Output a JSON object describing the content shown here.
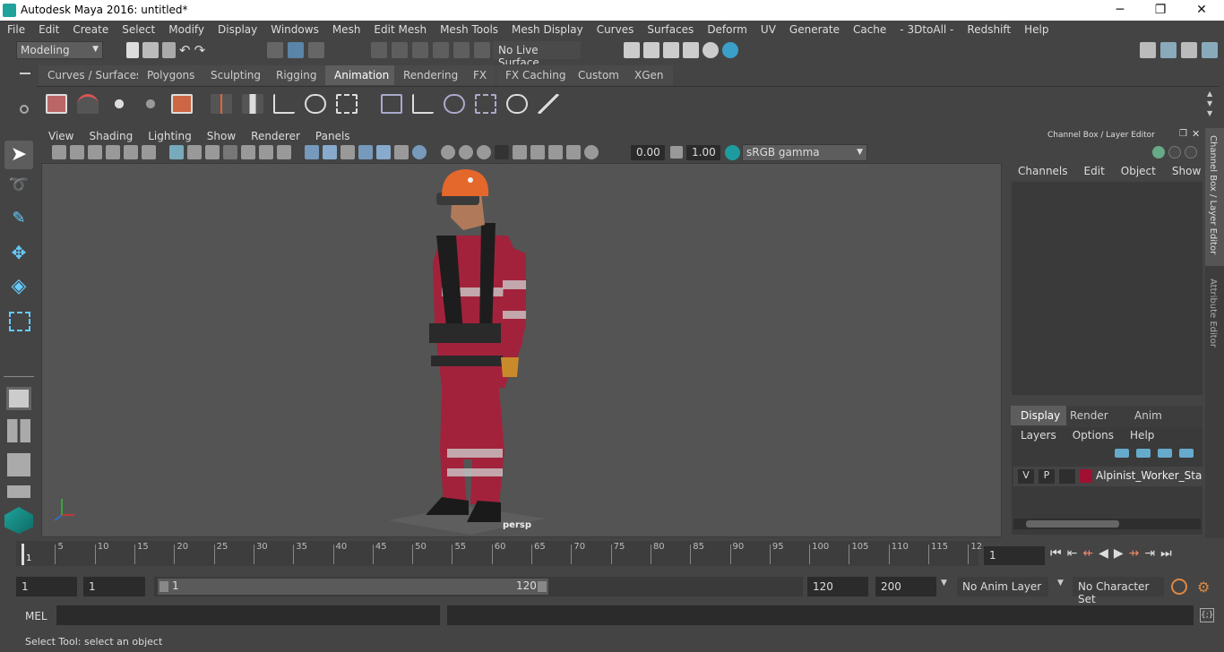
{
  "window": {
    "title": "Autodesk Maya 2016: untitled*",
    "minimize": "─",
    "restore": "❐",
    "close": "✕"
  },
  "menu": [
    "File",
    "Edit",
    "Create",
    "Select",
    "Modify",
    "Display",
    "Windows",
    "Mesh",
    "Edit Mesh",
    "Mesh Tools",
    "Mesh Display",
    "Curves",
    "Surfaces",
    "Deform",
    "UV",
    "Generate",
    "Cache",
    "- 3DtoAll -",
    "Redshift",
    "Help"
  ],
  "status": {
    "mode": "Modeling",
    "live_surface": "No Live Surface"
  },
  "shelf_tabs": [
    "Curves / Surfaces",
    "Polygons",
    "Sculpting",
    "Rigging",
    "Animation",
    "Rendering",
    "FX",
    "FX Caching",
    "Custom",
    "XGen"
  ],
  "active_shelf": "Animation",
  "viewport": {
    "menu": [
      "View",
      "Shading",
      "Lighting",
      "Show",
      "Renderer",
      "Panels"
    ],
    "exposure": "0.00",
    "gamma": "1.00",
    "colorspace": "sRGB gamma",
    "camera": "persp"
  },
  "channel_box": {
    "title": "Channel Box / Layer Editor",
    "menu": [
      "Channels",
      "Edit",
      "Object",
      "Show"
    ],
    "tabs": [
      "Display",
      "Render",
      "Anim"
    ],
    "active_tab": "Display",
    "layer_menu": [
      "Layers",
      "Options",
      "Help"
    ],
    "layer": {
      "v": "V",
      "p": "P",
      "name": "Alpinist_Worker_Standing",
      "color": "#a01030"
    },
    "side_tabs": [
      "Channel Box / Layer Editor",
      "Attribute Editor"
    ]
  },
  "timeline": {
    "ticks": [
      "1",
      "5",
      "10",
      "15",
      "20",
      "25",
      "30",
      "35",
      "40",
      "45",
      "50",
      "55",
      "60",
      "65",
      "70",
      "75",
      "80",
      "85",
      "90",
      "95",
      "100",
      "105",
      "110",
      "115",
      "12"
    ],
    "current_frame": "1"
  },
  "range": {
    "start": "1",
    "playback_start": "1",
    "slider_start": "1",
    "slider_end": "120",
    "playback_end": "120",
    "end": "200",
    "anim_layer": "No Anim Layer",
    "char_set": "No Character Set"
  },
  "command": {
    "label": "MEL"
  },
  "help_line": "Select Tool: select an object"
}
